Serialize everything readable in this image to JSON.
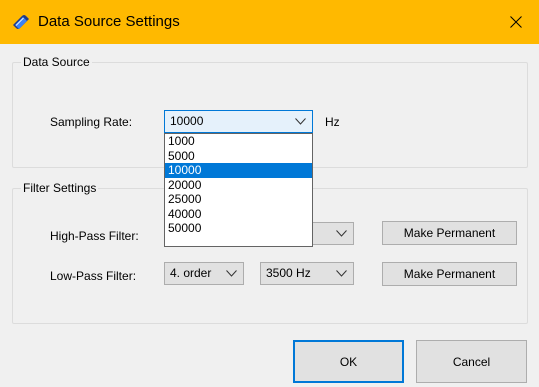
{
  "window": {
    "title": "Data Source Settings",
    "titlebar_color": "#ffb900",
    "icon": "book-icon",
    "close_icon": "close-icon"
  },
  "data_source": {
    "group_label": "Data Source",
    "sampling_rate_label": "Sampling Rate:",
    "sampling_rate_value": "10000",
    "sampling_rate_unit": "Hz",
    "sampling_rate_options": [
      "1000",
      "5000",
      "10000",
      "20000",
      "25000",
      "40000",
      "50000"
    ],
    "selected_index": 2
  },
  "filter_settings": {
    "group_label": "Filter Settings",
    "high_pass_label": "High-Pass Filter:",
    "high_pass_make_permanent": "Make Permanent",
    "low_pass_label": "Low-Pass Filter:",
    "low_pass_order": "4. order",
    "low_pass_freq": "3500 Hz",
    "low_pass_make_permanent": "Make Permanent"
  },
  "footer": {
    "ok_label": "OK",
    "cancel_label": "Cancel"
  },
  "colors": {
    "accent": "#0078d7",
    "selection": "#0078d7"
  }
}
